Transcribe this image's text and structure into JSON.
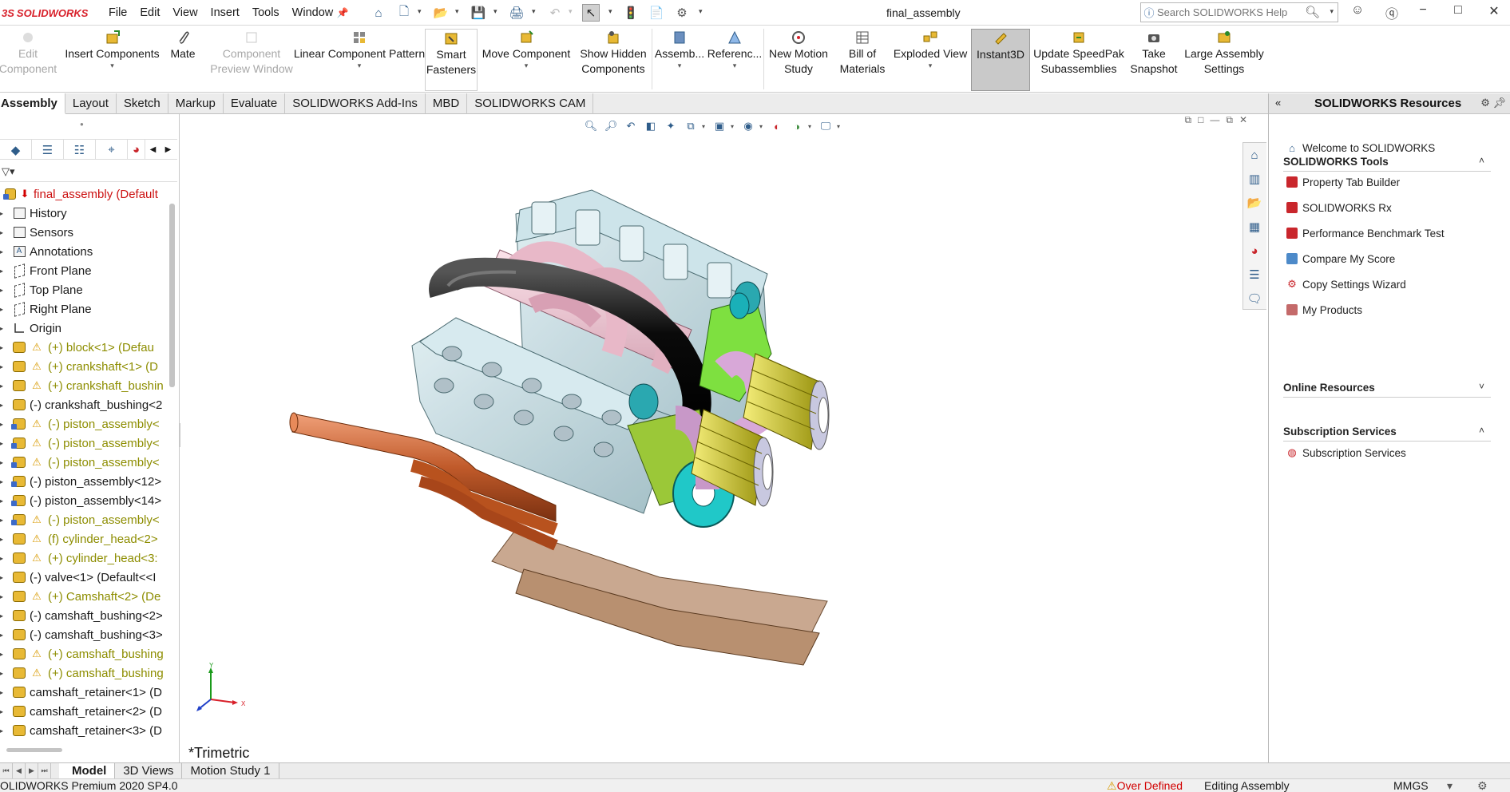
{
  "app": {
    "brand": "SOLIDWORKS",
    "document_title": "final_assembly"
  },
  "menu": [
    "File",
    "Edit",
    "View",
    "Insert",
    "Tools",
    "Window"
  ],
  "search": {
    "placeholder": "Search SOLIDWORKS Help"
  },
  "ribbon": {
    "edit_component": "Edit\nComponent",
    "insert_components": "Insert Components",
    "mate": "Mate",
    "component_preview": "Component\nPreview Window",
    "linear_pattern": "Linear Component Pattern",
    "smart_fasteners": "Smart\nFasteners",
    "move_component": "Move Component",
    "show_hidden": "Show Hidden\nComponents",
    "assembly": "Assemb...",
    "reference": "Referenc...",
    "new_motion_study": "New Motion\nStudy",
    "bill_of_materials": "Bill of\nMaterials",
    "exploded_view": "Exploded View",
    "instant3d": "Instant3D",
    "update_speedpak": "Update SpeedPak\nSubassemblies",
    "take_snapshot": "Take\nSnapshot",
    "large_assembly": "Large Assembly\nSettings"
  },
  "cm_tabs": [
    "Assembly",
    "Layout",
    "Sketch",
    "Markup",
    "Evaluate",
    "SOLIDWORKS Add-Ins",
    "MBD",
    "SOLIDWORKS CAM"
  ],
  "tree": {
    "root": "final_assembly  (Default",
    "items": [
      {
        "label": "History",
        "icon": "history-icon"
      },
      {
        "label": "Sensors",
        "icon": "sensors-icon"
      },
      {
        "label": "Annotations",
        "icon": "annotations-icon"
      },
      {
        "label": "Front Plane",
        "icon": "plane-icon"
      },
      {
        "label": "Top Plane",
        "icon": "plane-icon"
      },
      {
        "label": "Right Plane",
        "icon": "plane-icon"
      },
      {
        "label": "Origin",
        "icon": "origin-icon"
      },
      {
        "label": "(+) block<1> (Defau",
        "icon": "part-icon",
        "warn": true
      },
      {
        "label": "(+) crankshaft<1> (D",
        "icon": "part-icon",
        "warn": true
      },
      {
        "label": "(+) crankshaft_bushin",
        "icon": "part-icon",
        "warn": true
      },
      {
        "label": "(-) crankshaft_bushing<2",
        "icon": "part-icon",
        "warn": false
      },
      {
        "label": "(-) piston_assembly<",
        "icon": "assembly-icon",
        "warn": true
      },
      {
        "label": "(-) piston_assembly<",
        "icon": "assembly-icon",
        "warn": true
      },
      {
        "label": "(-) piston_assembly<",
        "icon": "assembly-icon",
        "warn": true
      },
      {
        "label": "(-) piston_assembly<12>",
        "icon": "assembly-icon",
        "warn": false
      },
      {
        "label": "(-) piston_assembly<14>",
        "icon": "assembly-icon",
        "warn": false
      },
      {
        "label": "(-) piston_assembly<",
        "icon": "assembly-icon",
        "warn": true
      },
      {
        "label": "(f) cylinder_head<2>",
        "icon": "part-icon",
        "warn": true
      },
      {
        "label": "(+) cylinder_head<3:",
        "icon": "part-icon",
        "warn": true
      },
      {
        "label": "(-) valve<1> (Default<<I",
        "icon": "part-icon",
        "warn": false
      },
      {
        "label": "(+) Camshaft<2> (De",
        "icon": "part-icon",
        "warn": true
      },
      {
        "label": "(-) camshaft_bushing<2>",
        "icon": "part-icon",
        "warn": false
      },
      {
        "label": "(-) camshaft_bushing<3>",
        "icon": "part-icon",
        "warn": false
      },
      {
        "label": "(+) camshaft_bushing",
        "icon": "part-icon",
        "warn": true
      },
      {
        "label": "(+) camshaft_bushing",
        "icon": "part-icon",
        "warn": true
      },
      {
        "label": "camshaft_retainer<1> (D",
        "icon": "part-icon",
        "warn": false
      },
      {
        "label": "camshaft_retainer<2> (D",
        "icon": "part-icon",
        "warn": false
      },
      {
        "label": "camshaft_retainer<3> (D",
        "icon": "part-icon",
        "warn": false
      }
    ]
  },
  "graphics": {
    "view_label": "*Trimetric",
    "triad_x": "X",
    "triad_y": "Y"
  },
  "task_pane": {
    "title": "SOLIDWORKS Resources",
    "welcome": "Welcome to SOLIDWORKS",
    "tools_title": "SOLIDWORKS Tools",
    "tools": [
      "Property Tab Builder",
      "SOLIDWORKS Rx",
      "Performance Benchmark Test",
      "Compare My Score",
      "Copy Settings Wizard",
      "My Products"
    ],
    "online_title": "Online Resources",
    "subscription_title": "Subscription Services",
    "subscription_link": "Subscription Services"
  },
  "bottom_tabs": [
    "Model",
    "3D Views",
    "Motion Study 1"
  ],
  "status": {
    "version": "OLIDWORKS Premium 2020 SP4.0",
    "over_defined": "Over Defined",
    "editing": "Editing Assembly",
    "units": "MMGS"
  },
  "colors": {
    "brand_red": "#d8202a",
    "warning_olive": "#8d8d00",
    "error_red": "#d20000"
  }
}
